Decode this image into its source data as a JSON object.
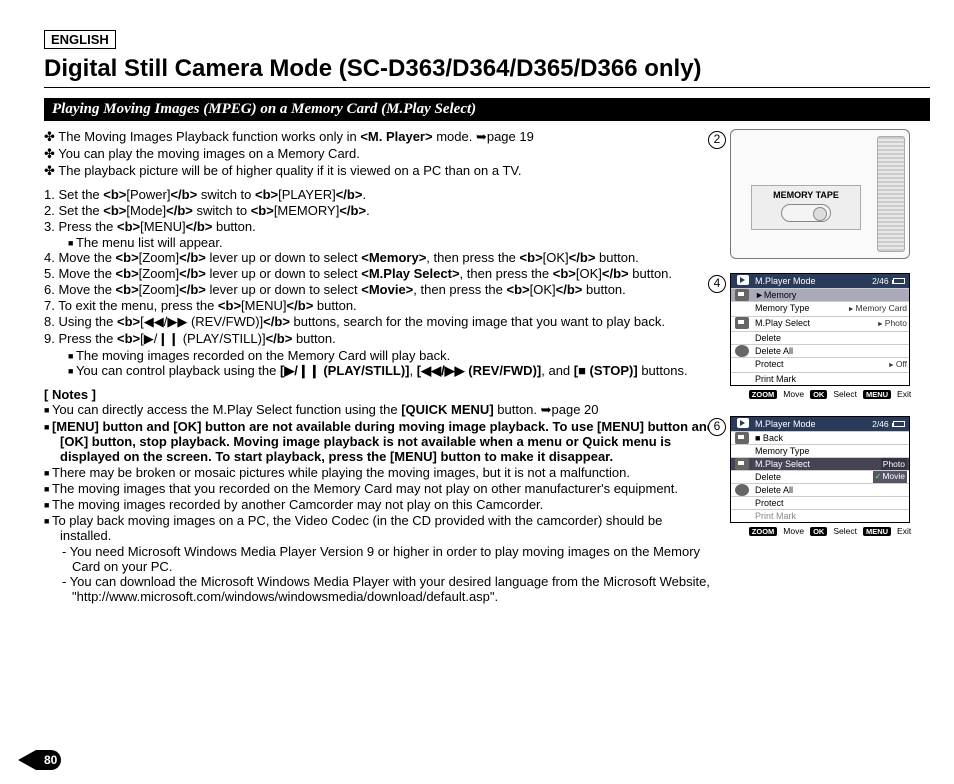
{
  "lang": "ENGLISH",
  "title": "Digital Still Camera Mode (SC-D363/D364/D365/D366 only)",
  "subtitle": "Playing Moving Images (MPEG) on a Memory Card (M.Play Select)",
  "intro": [
    "The Moving Images Playback function works only in <M. Player> mode. ➥page 19",
    "You can play the moving images on a Memory Card.",
    "The playback picture will be of higher quality if it is viewed on a PC  than on a TV."
  ],
  "steps": [
    {
      "n": "1.",
      "t": "Set the [Power] switch to [PLAYER]."
    },
    {
      "n": "2.",
      "t": "Set the [Mode] switch to [MEMORY]."
    },
    {
      "n": "3.",
      "t": "Press the [MENU] button.",
      "sub": [
        "The menu list will appear."
      ]
    },
    {
      "n": "4.",
      "t": "Move the [Zoom] lever up or down to select <Memory>, then press the [OK] button."
    },
    {
      "n": "5.",
      "t": "Move the [Zoom] lever up or down to select <M.Play Select>, then press the [OK] button."
    },
    {
      "n": "6.",
      "t": "Move the [Zoom] lever up or down to select <Movie>, then press the [OK] button."
    },
    {
      "n": "7.",
      "t": "To exit the menu, press the [MENU] button."
    },
    {
      "n": "8.",
      "t": "Using the [◀◀/▶▶ (REV/FWD)] buttons, search for the moving image that you want to play back."
    },
    {
      "n": "9.",
      "t": "Press the [▶/❙❙ (PLAY/STILL)] button.",
      "sub": [
        "The moving images recorded on the Memory Card will play back.",
        "You can control playback using the [▶/❙❙ (PLAY/STILL)], [◀◀/▶▶ (REV/FWD)], and [■ (STOP)] buttons."
      ]
    }
  ],
  "notes_title": "[ Notes ]",
  "notes": [
    {
      "t": "You can directly access the M.Play Select function using the [QUICK MENU] button. ➥page 20"
    },
    {
      "t": "[MENU] button and [OK] button are not available during moving image playback. To use [MENU] button and [OK] button, stop playback. Moving image playback is not available when a menu or Quick menu is displayed on the screen. To start playback, press the [MENU] button to make it disappear.",
      "bold": true
    },
    {
      "t": "There may be broken or mosaic pictures while playing the moving images, but it is not a malfunction."
    },
    {
      "t": "The moving images that you recorded on the Memory Card may not play on other manufacturer's equipment."
    },
    {
      "t": "The moving images recorded by another Camcorder may not play on this Camcorder."
    },
    {
      "t": "To play back moving images on a PC, the Video Codec (in the CD provided with the camcorder) should be installed.",
      "sub": [
        "-  You need Microsoft Windows Media Player Version 9 or higher in order to play moving images on the Memory Card on your PC.",
        "-  You can download the Microsoft Windows Media Player with your desired language from the Microsoft Website, \"http://www.microsoft.com/windows/windowsmedia/download/default.asp\"."
      ]
    }
  ],
  "page": "80",
  "diag": {
    "cam_label": "MEMORY  TAPE",
    "counter": "2/46",
    "menu4": {
      "title": "M.Player Mode",
      "rows": [
        {
          "label": "Memory",
          "sel": true
        },
        {
          "label": "Memory Type",
          "val": "Memory Card"
        },
        {
          "label": "M.Play Select",
          "val": "Photo"
        },
        {
          "label": "Delete"
        },
        {
          "label": "Delete All"
        },
        {
          "label": "Protect",
          "val": "Off"
        },
        {
          "label": "Print Mark"
        }
      ]
    },
    "menu6": {
      "title": "M.Player Mode",
      "rows": [
        {
          "label": "Back",
          "back": true
        },
        {
          "label": "Memory Type"
        },
        {
          "label": "M.Play Select",
          "sel": true,
          "opts": [
            "Photo",
            "Movie"
          ]
        },
        {
          "label": "Delete"
        },
        {
          "label": "Delete All"
        },
        {
          "label": "Protect"
        },
        {
          "label": "Print Mark",
          "grey": true
        }
      ]
    },
    "footer": {
      "zoom": "ZOOM",
      "move": "Move",
      "ok": "OK",
      "select": "Select",
      "menu": "MENU",
      "exit": "Exit"
    }
  }
}
